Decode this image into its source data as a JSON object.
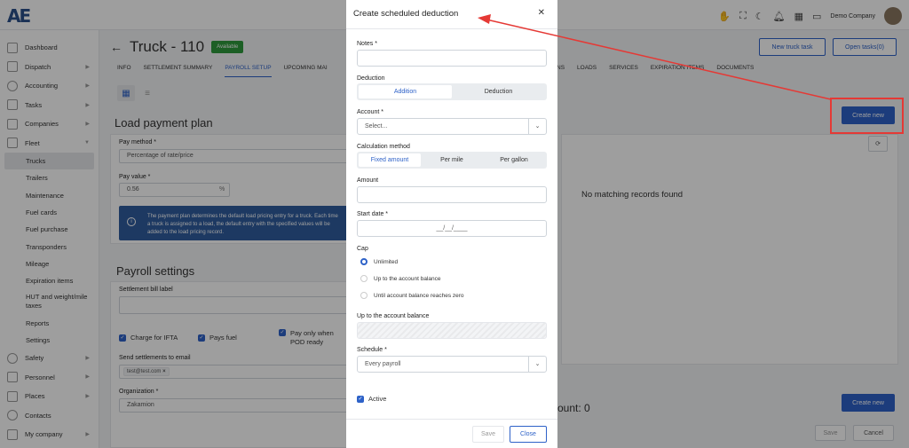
{
  "topbar": {
    "logo": "AE",
    "company": "Demo Company",
    "icons": [
      "hand-icon",
      "expand-icon",
      "moon-icon",
      "bell-icon",
      "grid-icon",
      "inbox-icon"
    ]
  },
  "sidebar": {
    "items": [
      {
        "label": "Dashboard",
        "icon": "dashboard-icon"
      },
      {
        "label": "Dispatch",
        "icon": "dispatch-icon"
      },
      {
        "label": "Accounting",
        "icon": "dollar-icon"
      },
      {
        "label": "Tasks",
        "icon": "tasks-icon"
      },
      {
        "label": "Companies",
        "icon": "building-icon"
      },
      {
        "label": "Fleet",
        "icon": "truck-icon"
      }
    ],
    "fleet_sub": [
      "Trucks",
      "Trailers",
      "Maintenance",
      "Fuel cards",
      "Fuel purchase",
      "Transponders",
      "Mileage",
      "Expiration items",
      "HUT and weight/mile taxes",
      "Reports",
      "Settings"
    ],
    "bottom_items": [
      {
        "label": "Safety",
        "icon": "shield-icon"
      },
      {
        "label": "Personnel",
        "icon": "id-card-icon"
      },
      {
        "label": "Places",
        "icon": "places-icon"
      },
      {
        "label": "Contacts",
        "icon": "phone-icon"
      },
      {
        "label": "My company",
        "icon": "home-icon"
      }
    ]
  },
  "page": {
    "title": "Truck - 110",
    "status": "Available",
    "tabs": [
      "INFO",
      "SETTLEMENT SUMMARY",
      "PAYROLL SETUP",
      "UPCOMING MAI"
    ],
    "tabs_right": [
      "NS",
      "LOADS",
      "SERVICES",
      "EXPIRATION ITEMS",
      "DOCUMENTS"
    ],
    "new_task": "New truck task",
    "open_tasks": "Open tasks(0)"
  },
  "load_plan": {
    "title": "Load payment plan",
    "pay_method_label": "Pay method *",
    "pay_method_value": "Percentage of rate/price",
    "pay_value_label": "Pay value *",
    "pay_value": "0.56",
    "pay_unit": "%",
    "info": "The payment plan determines the default load pricing entry for a truck. Each time a truck is assigned to a load, the default entry with the specified values will be added to the load pricing record."
  },
  "payroll": {
    "title": "Payroll settings",
    "bill_label": "Settlement bill label",
    "charge_ifta": "Charge for IFTA",
    "pays_fuel": "Pays fuel",
    "pod": "Pay only when POD ready",
    "send_email": "Send settlements to email",
    "email_tag": "test@test.com",
    "org_label": "Organization *",
    "org_value": "Zakamion"
  },
  "right_panel": {
    "create_new": "Create new",
    "empty": "No matching records found",
    "count_partial": "ount: 0",
    "create_new_2": "Create new",
    "save": "Save",
    "cancel": "Cancel"
  },
  "modal": {
    "title": "Create scheduled deduction",
    "notes_label": "Notes *",
    "deduction_label": "Deduction",
    "deduction_options": [
      "Addition",
      "Deduction"
    ],
    "account_label": "Account *",
    "account_placeholder": "Select...",
    "calc_label": "Calculation method",
    "calc_options": [
      "Fixed amount",
      "Per mile",
      "Per gallon"
    ],
    "amount_label": "Amount",
    "start_label": "Start date *",
    "start_placeholder": "__/__/____",
    "cap_label": "Cap",
    "cap_options": [
      "Unlimited",
      "Up to the account balance",
      "Until account balance reaches zero"
    ],
    "upto_label": "Up to the account balance",
    "schedule_label": "Schedule *",
    "schedule_value": "Every payroll",
    "active_label": "Active",
    "save": "Save",
    "close": "Close"
  },
  "colors": {
    "primary": "#2e62c8",
    "badge": "#2e9a3c",
    "annotation": "#e53935",
    "info": "#2f5d9f"
  }
}
